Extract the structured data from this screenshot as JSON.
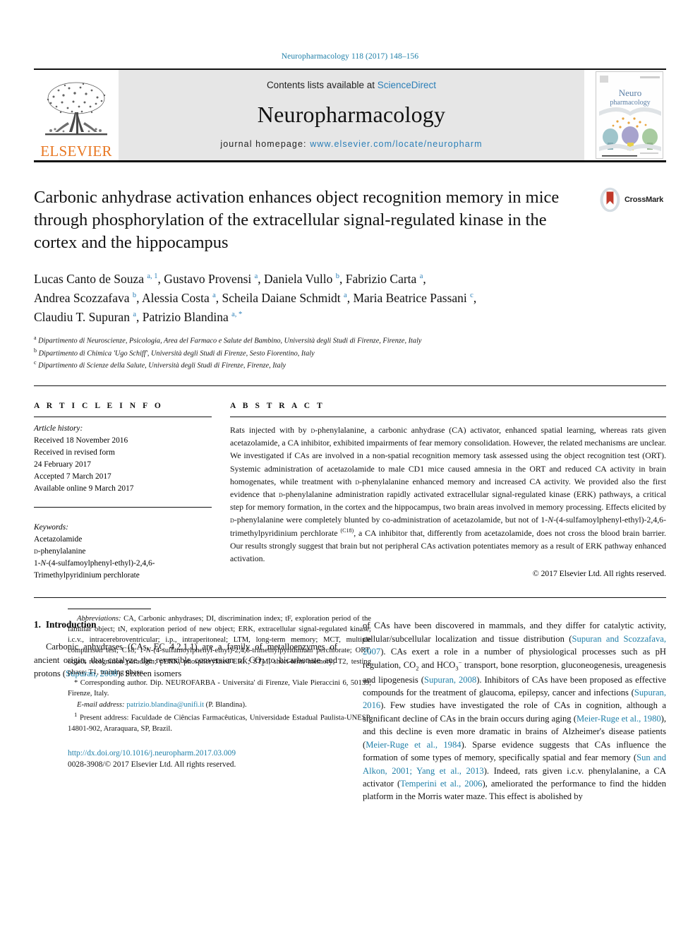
{
  "running_head": "Neuropharmacology 118 (2017) 148–156",
  "masthead": {
    "publisher": "ELSEVIER",
    "contents_prefix": "Contents lists available at ",
    "contents_link": "ScienceDirect",
    "journal_name": "Neuropharmacology",
    "homepage_prefix": "journal homepage: ",
    "homepage_url": "www.elsevier.com/locate/neuropharm",
    "cover_title_line1": "Neuro",
    "cover_title_line2": "pharmacology",
    "link_color": "#2b7fb8",
    "elsevier_orange": "#e87722"
  },
  "crossmark": {
    "label": "CrossMark"
  },
  "article": {
    "title": "Carbonic anhydrase activation enhances object recognition memory in mice through phosphorylation of the extracellular signal-regulated kinase in the cortex and the hippocampus",
    "authors_line1_a": "Lucas Canto de Souza ",
    "authors_line1_b": ", Gustavo Provensi ",
    "authors_line1_c": ", Daniela Vullo ",
    "authors_line1_d": ", Fabrizio Carta ",
    "authors_line2_a": "Andrea Scozzafava ",
    "authors_line2_b": ", Alessia Costa ",
    "authors_line2_c": ", Scheila Daiane Schmidt ",
    "authors_line2_d": ", Maria Beatrice Passani ",
    "authors_line3_a": "Claudiu T. Supuran ",
    "authors_line3_b": ", Patrizio Blandina ",
    "affiliations": [
      "Dipartimento di Neuroscienze, Psicologia, Area del Farmaco e Salute del Bambino, Università degli Studi di Firenze, Firenze, Italy",
      "Dipartimento di Chimica 'Ugo Schiff', Università degli Studi di Firenze, Sesto Fiorentino, Italy",
      "Dipartimento di Scienze della Salute, Università degli Studi di Firenze, Firenze, Italy"
    ],
    "affiliation_marks": [
      "a",
      "b",
      "c"
    ]
  },
  "article_info": {
    "heading": "A R T I C L E   I N F O",
    "history_label": "Article history:",
    "history": [
      "Received 18 November 2016",
      "Received in revised form",
      "24 February 2017",
      "Accepted 7 March 2017",
      "Available online 9 March 2017"
    ],
    "keywords_label": "Keywords:",
    "keywords": [
      "Acetazolamide",
      "d-phenylalanine",
      "1-N-(4-sulfamoylphenyl-ethyl)-2,4,6-",
      "Trimethylpyridinium perchlorate"
    ]
  },
  "abstract": {
    "heading": "A B S T R A C T",
    "text": "Rats injected with by d-phenylalanine, a carbonic anhydrase (CA) activator, enhanced spatial learning, whereas rats given acetazolamide, a CA inhibitor, exhibited impairments of fear memory consolidation. However, the related mechanisms are unclear. We investigated if CAs are involved in a non-spatial recognition memory task assessed using the object recognition test (ORT). Systemic administration of acetazolamide to male CD1 mice caused amnesia in the ORT and reduced CA activity in brain homogenates, while treatment with d-phenylalanine enhanced memory and increased CA activity. We provided also the first evidence that d-phenylalanine administration rapidly activated extracellular signal-regulated kinase (ERK) pathways, a critical step for memory formation, in the cortex and the hippocampus, two brain areas involved in memory processing. Effects elicited by d-phenylalanine were completely blunted by co-administration of acetazolamide, but not of 1-N-(4-sulfamoylphenyl-ethyl)-2,4,6-trimethylpyridinium perchlorate (C18), a CA inhibitor that, differently from acetazolamide, does not cross the blood brain barrier. Our results strongly suggest that brain but not peripheral CAs activation potentiates memory as a result of ERK pathway enhanced activation.",
    "superscript_note": "(C18)",
    "copyright": "© 2017 Elsevier Ltd. All rights reserved."
  },
  "introduction": {
    "number": "1.",
    "heading": "Introduction",
    "paragraph_left": "Carbonic anhydrases (CAs, EC 4.2.1.1) are a family of metalloenzymes of ancient origin, that catalyze the reversible conversion of CO2 to bicarbonate and protons (Supuran, 2008). Sixteen isomers",
    "left_refs": [
      "Supuran, 2008"
    ],
    "paragraph_right": "of CAs have been discovered in mammals, and they differ for catalytic activity, cellular/subcellular localization and tissue distribution (Supuran and Scozzafava, 2007). CAs exert a role in a number of physiological processes such as pH regulation, CO2 and HCO3- transport, bone resorption, gluconeogenesis, ureagenesis and lipogenesis (Supuran, 2008). Inhibitors of CAs have been proposed as effective compounds for the treatment of glaucoma, epilepsy, cancer and infections (Supuran, 2016). Few studies have investigated the role of CAs in cognition, although a significant decline of CAs in the brain occurs during aging (Meier-Ruge et al., 1980), and this decline is even more dramatic in brains of Alzheimer's disease patients (Meier-Ruge et al., 1984). Sparse evidence suggests that CAs influence the formation of some types of memory, specifically spatial and fear memory (Sun and Alkon, 2001; Yang et al., 2013). Indeed, rats given i.c.v. phenylalanine, a CA activator (Temperini et al., 2006), ameliorated the performance to find the hidden platform in the Morris water maze. This effect is abolished by",
    "right_refs": [
      "Supuran and Scozzafava, 2007",
      "Supuran, 2008",
      "Supuran, 2016",
      "Meier-Ruge et al., 1980",
      "Meier-Ruge et al., 1984",
      "Sun and Alkon, 2001; Yang et al., 2013",
      "Temperini et al., 2006"
    ]
  },
  "footnotes": {
    "abbreviations_label": "Abbreviations:",
    "abbreviations_text": "CA, Carbonic anhydrases; DI, discrimination index; tF, exploration period of the familiar object; tN, exploration period of new object; ERK, extracellular signal-regulated kinase; i.c.v., intracerebroventricular; i.p., intraperitoneal; LTM, long-term memory; MCT, multiple comparison test; C18, 1-N-(4-sulfamoylphenyl-ethyl)-2,4,6-trimethylpyridinium perchlorate; ORT, object recognition paradigm; pERK, phosphorylated ERK; STM, short-term memory; T2, testing phase; T1, training phase.",
    "corresponding_marker": "*",
    "corresponding_text": "Corresponding author. Dip. NEUROFARBA - Universita' di Firenze, Viale Pieraccini 6, 50139, Firenze, Italy.",
    "email_label": "E-mail address:",
    "email": "patrizio.blandina@unifi.it",
    "email_suffix": "(P. Blandina).",
    "present_marker": "1",
    "present_address": "Present address: Faculdade de Ciências Farmacêuticas, Universidade Estadual Paulista-UNESP, 14801-902, Araraquara, SP, Brazil.",
    "doi": "http://dx.doi.org/10.1016/j.neuropharm.2017.03.009",
    "issn": "0028-3908/© 2017 Elsevier Ltd. All rights reserved."
  }
}
